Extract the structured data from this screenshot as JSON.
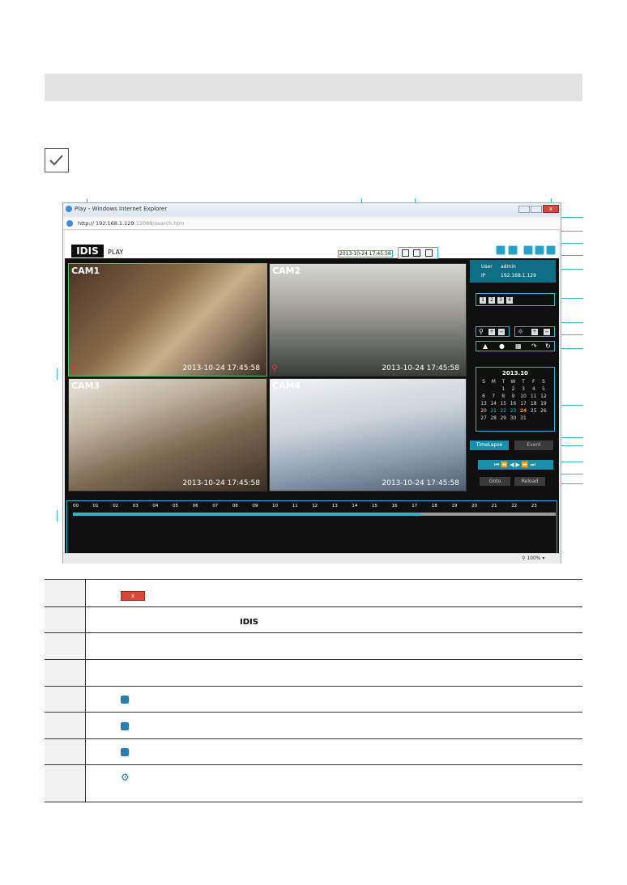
{
  "browser": {
    "title": "Play - Windows Internet Explorer",
    "address_host": "192.168.1.129",
    "address_rest": ":12088/search.htm",
    "zoom": "100%"
  },
  "app": {
    "logo_text": "IDIS",
    "logo_suffix": "PLAY",
    "datetime": "2013-10-24 17:45:58"
  },
  "cameras": [
    {
      "label": "CAM1",
      "timestamp": "2013-10-24 17:45:58"
    },
    {
      "label": "CAM2",
      "timestamp": "2013-10-24 17:45:58"
    },
    {
      "label": "CAM3",
      "timestamp": "2013-10-24 17:45:58"
    },
    {
      "label": "CAM4",
      "timestamp": "2013-10-24 17:45:58"
    }
  ],
  "user_panel": {
    "user_label": "User",
    "user_value": "admin",
    "ip_label": "IP",
    "ip_value": "192.168.1.129"
  },
  "camera_buttons": [
    "1",
    "2",
    "3",
    "4"
  ],
  "calendar": {
    "title": "2013.10",
    "weekdays": [
      "S",
      "M",
      "T",
      "W",
      "T",
      "F",
      "S"
    ],
    "weeks": [
      [
        "",
        "",
        "1",
        "2",
        "3",
        "4",
        "5"
      ],
      [
        "6",
        "7",
        "8",
        "9",
        "10",
        "11",
        "12"
      ],
      [
        "13",
        "14",
        "15",
        "16",
        "17",
        "18",
        "19"
      ],
      [
        "20",
        "21",
        "22",
        "23",
        "24",
        "25",
        "26"
      ],
      [
        "27",
        "28",
        "29",
        "30",
        "31",
        "",
        ""
      ]
    ]
  },
  "buttons": {
    "timelapse": "TimeLapse",
    "event": "Event",
    "goto": "Goto",
    "reload": "Reload"
  },
  "timeline_hours": [
    "00",
    "01",
    "02",
    "03",
    "04",
    "05",
    "06",
    "07",
    "08",
    "09",
    "10",
    "11",
    "12",
    "13",
    "14",
    "15",
    "16",
    "17",
    "18",
    "19",
    "20",
    "21",
    "22",
    "23"
  ],
  "timeline_progress": 0.72,
  "colors": {
    "accent": "#2bb9cf",
    "close": "#d9473b",
    "section_bar": "#e3e3e3"
  }
}
